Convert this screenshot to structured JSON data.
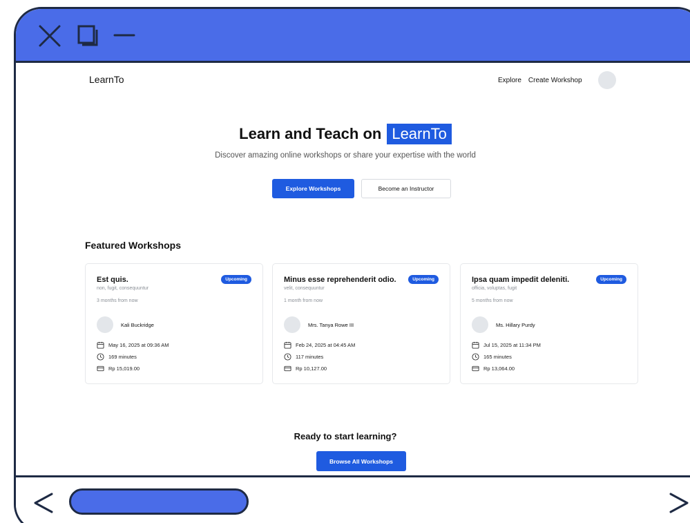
{
  "window": {
    "icons": [
      "close-icon",
      "maximize-icon",
      "minimize-icon"
    ],
    "accent_color": "#4a6ce8",
    "border_color": "#1e2a44"
  },
  "navbar": {
    "brand": "LearnTo",
    "links": [
      "Explore",
      "Create Workshop"
    ]
  },
  "hero": {
    "title_prefix": "Learn and Teach on",
    "title_brand": "LearnTo",
    "subtitle": "Discover amazing online workshops or share your expertise with the world",
    "primary_button": "Explore Workshops",
    "secondary_button": "Become an Instructor",
    "brand_color": "#1f5be0"
  },
  "featured": {
    "title": "Featured Workshops",
    "cards": [
      {
        "title": "Est quis.",
        "badge": "Upcoming",
        "tags": "non, fugit, consequuntur",
        "relative_time": "3 months from now",
        "instructor": "Kali Buckridge",
        "date": "May 16, 2025 at 09:36 AM",
        "duration": "169 minutes",
        "price": "Rp 15,019.00"
      },
      {
        "title": "Minus esse reprehenderit odio.",
        "badge": "Upcoming",
        "tags": "velit, consequuntur",
        "relative_time": "1 month from now",
        "instructor": "Mrs. Tanya Rowe III",
        "date": "Feb 24, 2025 at 04:45 AM",
        "duration": "117 minutes",
        "price": "Rp 10,127.00"
      },
      {
        "title": "Ipsa quam impedit deleniti.",
        "badge": "Upcoming",
        "tags": "officia, voluptas, fugit",
        "relative_time": "5 months from now",
        "instructor": "Ms. Hillary Purdy",
        "date": "Jul 15, 2025 at 11:34 PM",
        "duration": "165 minutes",
        "price": "Rp 13,064.00"
      }
    ]
  },
  "cta": {
    "title": "Ready to start learning?",
    "button": "Browse All Workshops"
  },
  "bottom_nav": {
    "icons": [
      "back-arrow-icon",
      "forward-arrow-icon"
    ]
  }
}
